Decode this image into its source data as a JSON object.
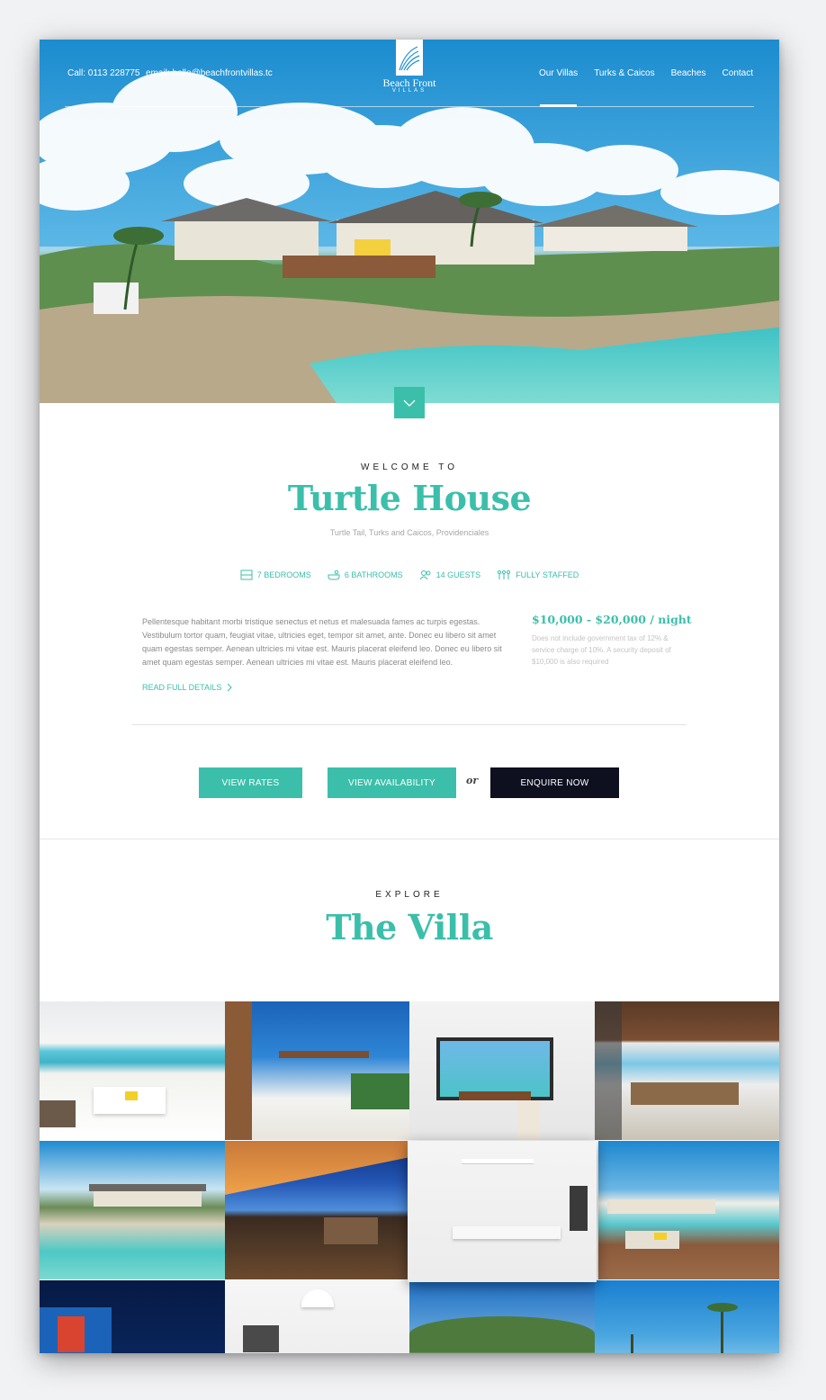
{
  "header": {
    "phone": "Call: 0113 228775",
    "email": "email: hello@beachfrontvillas.tc",
    "logo_name": "Beach Front",
    "logo_sub": "VILLAS",
    "nav": [
      {
        "label": "Our Villas",
        "active": true
      },
      {
        "label": "Turks & Caicos",
        "active": false
      },
      {
        "label": "Beaches",
        "active": false
      },
      {
        "label": "Contact",
        "active": false
      }
    ]
  },
  "welcome": {
    "eyebrow": "WELCOME TO",
    "title": "Turtle House",
    "location": "Turtle Tail, Turks and Caicos, Providenciales",
    "features": [
      {
        "icon": "bed-icon",
        "label": "7 BEDROOMS"
      },
      {
        "icon": "bath-icon",
        "label": "6 BATHROOMS"
      },
      {
        "icon": "guests-icon",
        "label": "14 GUESTS"
      },
      {
        "icon": "staff-icon",
        "label": "FULLY STAFFED"
      }
    ],
    "description": "Pellentesque habitant morbi tristique senectus et netus et malesuada fames ac turpis egestas. Vestibulum tortor quam, feugiat vitae, ultricies eget, tempor sit amet, ante. Donec eu libero sit amet quam egestas semper. Aenean ultricies mi vitae est. Mauris placerat eleifend leo. Donec eu libero sit amet quam egestas semper. Aenean ultricies mi vitae est. Mauris placerat eleifend leo.",
    "read_more": "READ FULL DETAILS",
    "price": "$10,000 - $20,000 / night",
    "price_note": "Does not include government tax of 12% & service charge of 10%. A security deposit of $10,000 is also required"
  },
  "actions": {
    "view_rates": "VIEW RATES",
    "view_availability": "VIEW AVAILABILITY",
    "or": "or",
    "enquire": "ENQUIRE NOW"
  },
  "explore": {
    "eyebrow": "EXPLORE",
    "title": "The Villa"
  },
  "colors": {
    "accent": "#3bbfaa",
    "dark": "#0e1020",
    "hero_sky": "#1c8fd0"
  }
}
